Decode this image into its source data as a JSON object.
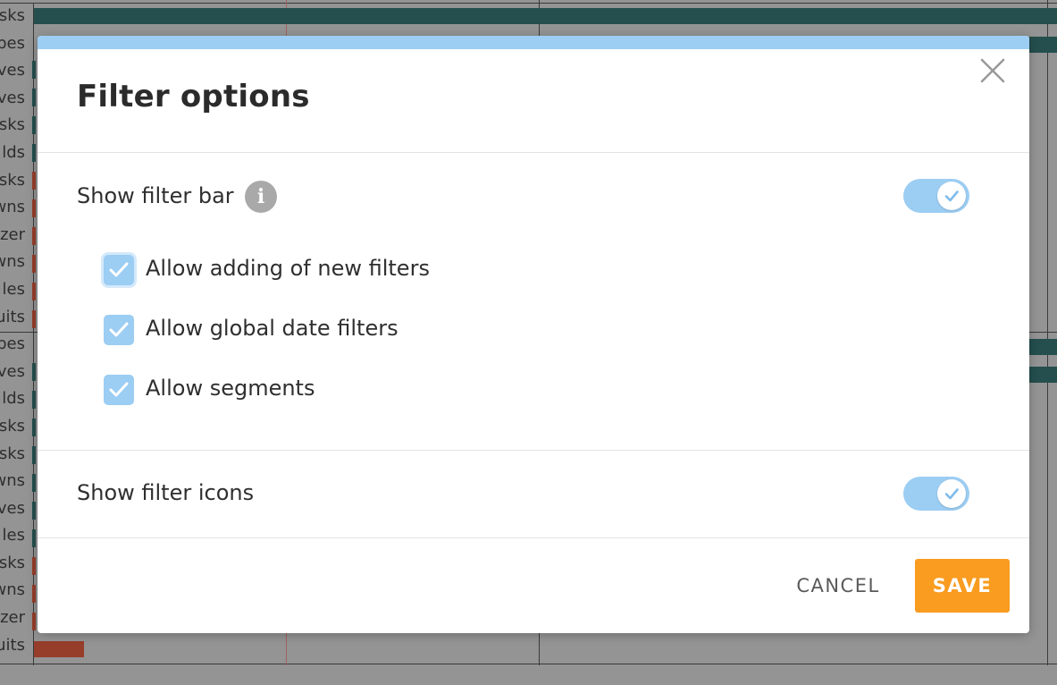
{
  "background": {
    "row_labels": [
      "sks",
      "pes",
      "ves",
      "ves",
      "sks",
      "lds",
      "sks",
      "wns",
      "zer",
      "wns",
      "les",
      "uits",
      "pes",
      "ves",
      "lds",
      "sks",
      "sks",
      "wns",
      "ves",
      "les",
      "sks",
      "wns",
      "zer",
      "uits"
    ]
  },
  "modal": {
    "title": "Filter options",
    "close_icon": "close-icon",
    "accent_color": "#9ccdf3",
    "show_filter_bar": {
      "label": "Show filter bar",
      "info_glyph": "i",
      "enabled": true
    },
    "checkboxes": [
      {
        "label": "Allow adding of new filters",
        "checked": true
      },
      {
        "label": "Allow global date filters",
        "checked": true
      },
      {
        "label": "Allow segments",
        "checked": true
      }
    ],
    "show_filter_icons": {
      "label": "Show filter icons",
      "enabled": true
    },
    "buttons": {
      "cancel": "CANCEL",
      "save": "SAVE",
      "save_color": "#f99c20"
    }
  }
}
